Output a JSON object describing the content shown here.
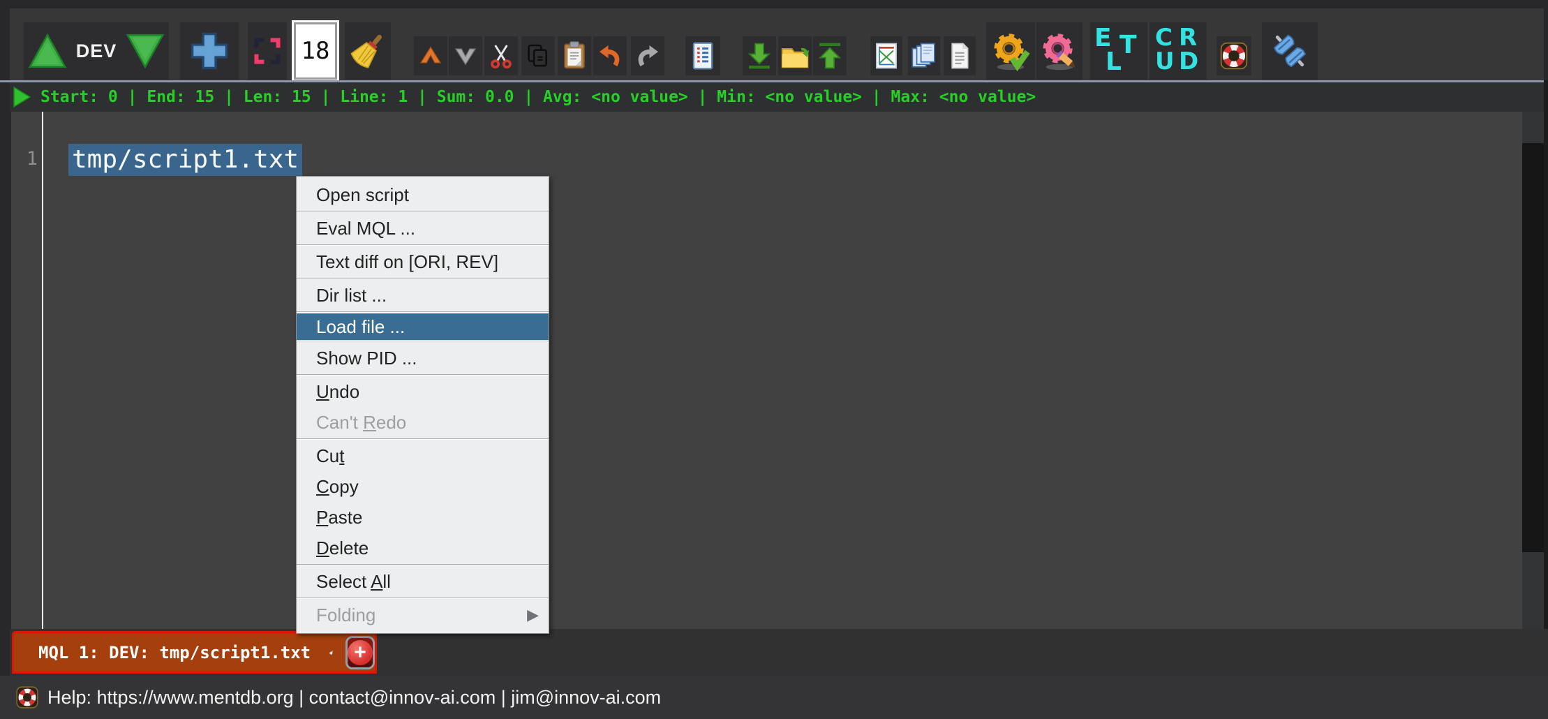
{
  "toolbar": {
    "env_label": "DEV",
    "font_size_value": "18",
    "buttons": [
      {
        "id": "dev",
        "name": "env-switcher-button",
        "icons": [
          "triangle-up-icon",
          "triangle-down-icon"
        ],
        "label": "DEV"
      },
      {
        "id": "plus",
        "name": "new-script-button",
        "icon": "plus-icon"
      },
      {
        "id": "corners",
        "name": "selection-frame-button",
        "icon": "selection-corners-icon"
      },
      {
        "id": "fontsize",
        "name": "font-size-box",
        "value": "18"
      },
      {
        "id": "broom",
        "name": "clean-button",
        "icon": "broom-icon"
      },
      {
        "id": "navup",
        "name": "navigate-up-button",
        "icon": "chevron-up-icon"
      },
      {
        "id": "navdown",
        "name": "navigate-down-button",
        "icon": "chevron-down-icon"
      },
      {
        "id": "cut",
        "name": "cut-button",
        "icon": "scissors-icon"
      },
      {
        "id": "copy",
        "name": "copy-button",
        "icon": "copy-icon"
      },
      {
        "id": "paste",
        "name": "paste-button",
        "icon": "clipboard-icon"
      },
      {
        "id": "undo",
        "name": "undo-button",
        "icon": "undo-arrow-icon"
      },
      {
        "id": "redo",
        "name": "redo-button",
        "icon": "redo-arrow-icon"
      },
      {
        "id": "execlog",
        "name": "execute-log-button",
        "icon": "document-list-icon"
      },
      {
        "id": "import",
        "name": "import-button",
        "icon": "download-arrow-icon"
      },
      {
        "id": "folder",
        "name": "open-folder-button",
        "icon": "folder-icon"
      },
      {
        "id": "export",
        "name": "export-button",
        "icon": "upload-arrow-icon"
      },
      {
        "id": "chart",
        "name": "chart-button",
        "icon": "chart-icon"
      },
      {
        "id": "pages",
        "name": "pages-button",
        "icon": "stacked-pages-icon"
      },
      {
        "id": "doc",
        "name": "document-button",
        "icon": "document-icon"
      },
      {
        "id": "gearcheck",
        "name": "process-run-button",
        "icon": "gear-check-icon"
      },
      {
        "id": "gearedit",
        "name": "process-edit-button",
        "icon": "gear-edit-icon"
      },
      {
        "id": "elt",
        "name": "elt-button",
        "text_icon": "ELT"
      },
      {
        "id": "crud",
        "name": "crud-button",
        "text_icon": "CRUD"
      },
      {
        "id": "lifebuoy",
        "name": "help-button",
        "icon": "lifebuoy-icon"
      },
      {
        "id": "plug",
        "name": "connector-button",
        "icon": "plug-icon"
      }
    ]
  },
  "status_bar": {
    "text": "Start: 0 | End: 15 | Len: 15 | Line: 1 | Sum: 0.0 | Avg: <no value> | Min: <no value> | Max: <no value>",
    "fields": {
      "start": "0",
      "end": "15",
      "len": "15",
      "line": "1",
      "sum": "0.0",
      "avg": "<no value>",
      "min": "<no value>",
      "max": "<no value>"
    }
  },
  "editor": {
    "line_number": "1",
    "line1_text": "tmp/script1.txt",
    "selection_active": true
  },
  "context_menu": {
    "items": [
      {
        "label": "Open script",
        "mnemonic_index": -1,
        "sep_after": true
      },
      {
        "label": "Eval MQL ...",
        "mnemonic_index": -1,
        "sep_after": true
      },
      {
        "label": "Text diff on [ORI, REV]",
        "mnemonic_index": -1,
        "sep_after": true
      },
      {
        "label": "Dir list ...",
        "mnemonic_index": -1,
        "sep_after": true
      },
      {
        "label": "Load file ...",
        "mnemonic_index": -1,
        "highlighted": true,
        "compact": true,
        "sep_after": true
      },
      {
        "label": "Show PID ...",
        "mnemonic_index": -1,
        "sep_after": true
      },
      {
        "label": "Undo",
        "mnemonic_index": 0
      },
      {
        "label": "Can't Redo",
        "mnemonic_index": 6,
        "disabled": true,
        "sep_after": true
      },
      {
        "label": "Cut",
        "mnemonic_index": 2
      },
      {
        "label": "Copy",
        "mnemonic_index": 0
      },
      {
        "label": "Paste",
        "mnemonic_index": 0
      },
      {
        "label": "Delete",
        "mnemonic_index": 0,
        "sep_after": true
      },
      {
        "label": "Select All",
        "mnemonic_index": 7,
        "sep_after": true
      },
      {
        "label": "Folding",
        "mnemonic_index": -1,
        "disabled": true,
        "submenu": true
      }
    ]
  },
  "tab_bar": {
    "tab_label": "MQL 1: DEV: tmp/script1.txt",
    "add_button_label": "+"
  },
  "help_bar": {
    "text": "Help: https://www.mentdb.org | contact@innov-ai.com | jim@innov-ai.com"
  },
  "colors": {
    "selection_blue": "#3a658d",
    "menu_highlight_blue": "#3a6d94",
    "status_green": "#26d026",
    "tab_orange": "#a5400e",
    "tab_border_red": "#de1505",
    "toolbar_bg": "#373738",
    "editor_bg": "#414142"
  }
}
